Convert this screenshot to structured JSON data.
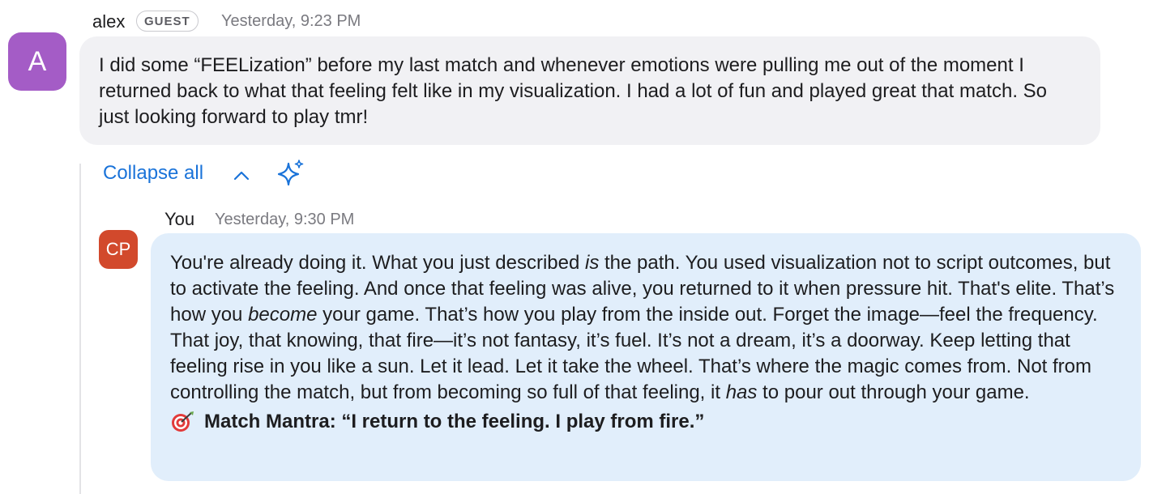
{
  "message": {
    "avatar_letter": "A",
    "sender": "alex",
    "badge": "GUEST",
    "timestamp": "Yesterday, 9:23 PM",
    "body": "I did some “FEELization” before my last match and whenever emotions were pulling me out of the moment I returned back to what that feeling felt like in my visualization. I had a lot of fun and played great that match. So just looking forward to play tmr!"
  },
  "thread": {
    "collapse_label": "Collapse all",
    "collapse_icon": "chevron-up-icon",
    "ai_icon": "sparkle-icon"
  },
  "reply": {
    "sender": "You",
    "timestamp": "Yesterday, 9:30 PM",
    "avatar_initials": "CP",
    "body_p1": "You're already doing it. What you just described ",
    "body_em1": "is",
    "body_p2": " the path. You used visualization not to script outcomes, but to activate the feeling. And once that feeling was alive, you returned to it when pressure hit. That's elite. That’s how you ",
    "body_em2": "become",
    "body_p3": " your game. That’s how you play from the inside out. Forget the image—feel the frequency. That joy, that knowing, that fire—it’s not fantasy, it’s fuel. It’s not a dream, it’s a doorway. Keep letting that feeling rise in you like a sun. Let it lead. Let it take the wheel. That’s where the magic comes from. Not from controlling the match, but from becoming so full of that feeling, it ",
    "body_em3": "has",
    "body_p4": " to pour out through your game.",
    "mantra_icon": "target-icon",
    "mantra": "Match Mantra: “I return to the feeling. I play from fire.”"
  },
  "colors": {
    "guest_avatar": "#a45cc6",
    "user_avatar": "#d2492c",
    "link": "#1a73d9",
    "guest_bubble": "#f1f1f4",
    "user_bubble": "#e1eefb"
  }
}
